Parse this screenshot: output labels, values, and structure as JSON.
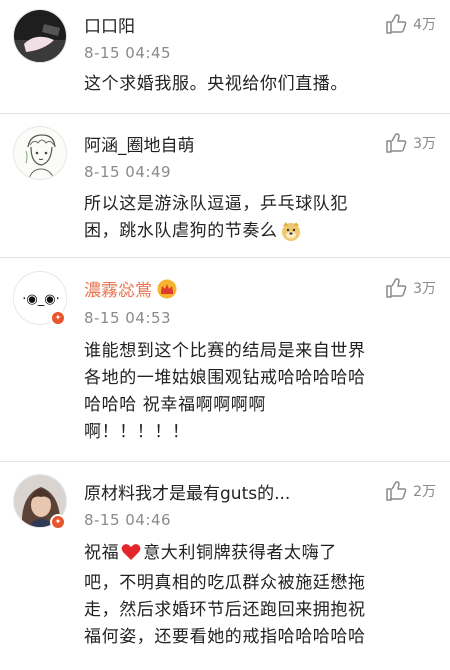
{
  "comments": [
    {
      "user": "口口阳",
      "time": "8-15 04:45",
      "likes": "4万",
      "text": "这个求婚我服。央视给你们直播。",
      "avatar": "dark-photo-avatar"
    },
    {
      "user": "阿涵_圈地自萌",
      "time": "8-15 04:49",
      "likes": "3万",
      "text": "所以这是游泳队逗逼，乒乓球队犯\n困，跳水队虐狗的节奏么",
      "emoji": "doge-emoji",
      "avatar": "sketch-avatar"
    },
    {
      "user": "濃霧惢鴬",
      "time": "8-15 04:53",
      "likes": "3万",
      "text": "谁能想到这个比赛的结局是来自世界\n各地的一堆姑娘围观钻戒哈哈哈哈哈\n哈哈哈  祝幸福啊啊啊啊\n啊！！！！！",
      "avatar": "emoticon-avatar",
      "name_color": "#eb7350"
    },
    {
      "user": "原材料我才是最有guts的...",
      "time": "8-15 04:46",
      "likes": "2万",
      "text_before_heart": "祝福",
      "text": "意大利铜牌获得者太嗨了\n吧，不明真相的吃瓜群众被施廷懋拖\n走，然后求婚环节后还跑回来拥抱祝\n福何姿，还要看她的戒指哈哈哈哈哈",
      "avatar": "woman-photo-avatar",
      "heart_color": "#e4252b"
    }
  ],
  "colors": {
    "accent": "#eb7350",
    "time": "#8a8a8a",
    "badge": "#e8542b"
  }
}
